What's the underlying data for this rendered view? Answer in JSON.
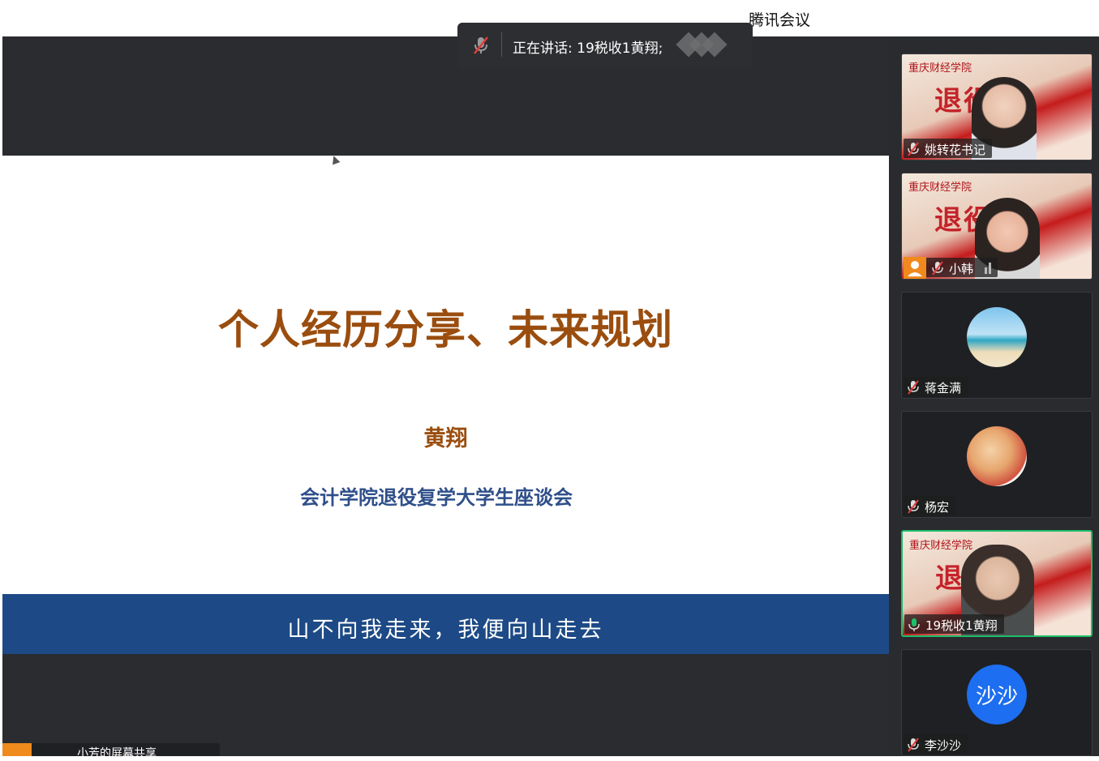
{
  "window": {
    "title": "腾讯会议"
  },
  "speaking": {
    "text": "正在讲话: 19税收1黄翔;"
  },
  "slide": {
    "title": "个人经历分享、未来规划",
    "author": "黄翔",
    "subtitle": "会计学院退役复学大学生座谈会",
    "banner": "山不向我走来，我便向山走去"
  },
  "participants": [
    {
      "name": "姚转花书记",
      "video": true,
      "bg_school": "重庆财经学院",
      "muted": true
    },
    {
      "name": "小韩",
      "video": true,
      "bg_school": "重庆财经学院",
      "muted": true,
      "host_badge": true
    },
    {
      "name": "蒋金满",
      "video": false,
      "avatar": "beach-avatar",
      "muted": true
    },
    {
      "name": "杨宏",
      "video": false,
      "avatar": "cartoon-avatar",
      "muted": true
    },
    {
      "name": "19税收1黄翔",
      "video": true,
      "bg_school": "重庆财经学院",
      "muted": false,
      "speaking": true
    },
    {
      "name": "李沙沙",
      "video": false,
      "avatar_initials": "沙沙",
      "muted": true
    }
  ],
  "bottom_label": {
    "text": "小芳的屏幕共享"
  },
  "colors": {
    "accent_green": "#1dbf6a",
    "banner_blue": "#1d4a86",
    "title_brown": "#9a4d0e",
    "avatar_blue": "#1d6ef0"
  }
}
